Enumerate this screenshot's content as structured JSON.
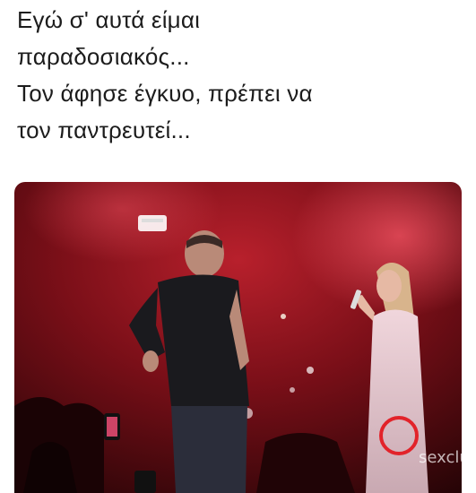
{
  "caption": {
    "lines": [
      "Εγώ σ' αυτά είμαι",
      "παραδοσιακός...",
      "Τον άφησε έγκυο, πρέπει να",
      "τον παντρευτεί..."
    ]
  },
  "watermark": {
    "logo": "sexclub.gr"
  },
  "colors": {
    "stage_red": "#8a1018",
    "stage_dark": "#2a0608",
    "accent": "#e2232a"
  }
}
